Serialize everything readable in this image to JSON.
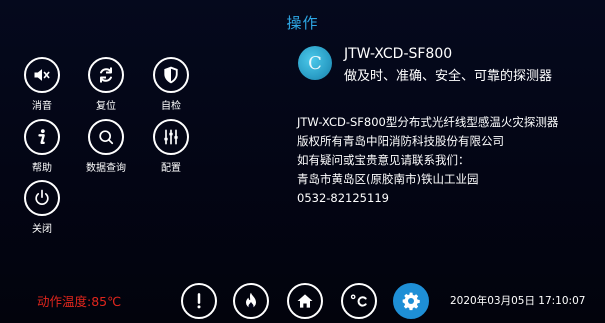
{
  "header": {
    "title": "操作"
  },
  "menu": [
    {
      "label": "消音",
      "icon": "mute-icon"
    },
    {
      "label": "复位",
      "icon": "reset-icon"
    },
    {
      "label": "自检",
      "icon": "shield-icon"
    },
    {
      "label": "帮助",
      "icon": "info-icon"
    },
    {
      "label": "数据查询",
      "icon": "search-icon"
    },
    {
      "label": "配置",
      "icon": "sliders-icon"
    },
    {
      "label": "关闭",
      "icon": "power-icon"
    }
  ],
  "product": {
    "logo_text": "C",
    "name": "JTW-XCD-SF800",
    "slogan": "做及时、准确、安全、可靠的探测器"
  },
  "info": {
    "lines": [
      "JTW-XCD-SF800型分布式光纤线型感温火灾探测器",
      "版权所有青岛中阳消防科技股份有限公司",
      "如有疑问或宝贵意见请联系我们：",
      "青岛市黄岛区(原胶南市)铁山工业园",
      "0532-82125119"
    ]
  },
  "footer": {
    "status": "动作温度:85℃",
    "datetime": "2020年03月05日 17:10:07",
    "nav": [
      {
        "icon": "alarm-icon",
        "active": false
      },
      {
        "icon": "fire-icon",
        "active": false
      },
      {
        "icon": "home-icon",
        "active": false
      },
      {
        "icon": "temperature-icon",
        "active": false
      },
      {
        "icon": "gear-icon",
        "active": true
      }
    ]
  },
  "colors": {
    "accent": "#2ea8e6",
    "active": "#1e8fd6",
    "alert": "#e0261d",
    "background": "#03051a"
  }
}
